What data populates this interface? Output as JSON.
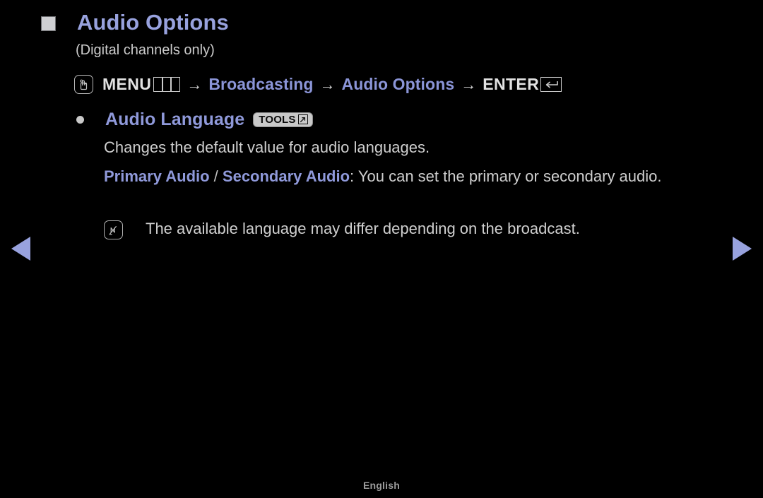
{
  "page": {
    "language_footer": "English",
    "background_color": "#000000",
    "accent_color": "#98a2de",
    "text_color": "#cfcfcf"
  },
  "header": {
    "marker_icon": "filled-square-icon",
    "title": "Audio Options",
    "subtitle": "(Digital channels only)"
  },
  "menu_path": {
    "touch_icon": "hand-press-icon",
    "segments": [
      {
        "type": "key",
        "label": "MENU",
        "glyph": "menu-grid-glyph",
        "style": "white"
      },
      {
        "type": "arrow",
        "label": "→"
      },
      {
        "type": "menu",
        "label": "Broadcasting",
        "style": "blue"
      },
      {
        "type": "arrow",
        "label": "→"
      },
      {
        "type": "menu",
        "label": "Audio Options",
        "style": "blue"
      },
      {
        "type": "arrow",
        "label": "→"
      },
      {
        "type": "key",
        "label": "ENTER",
        "glyph": "enter-return-glyph",
        "style": "white"
      }
    ]
  },
  "content": {
    "bullet_icon": "bullet-dot-icon",
    "item_title": "Audio Language",
    "tools_badge": {
      "label": "TOOLS",
      "icon": "arrow-out-box-icon"
    },
    "description_1": "Changes the default value for audio languages.",
    "description_2": {
      "term_primary": "Primary Audio",
      "separator": " / ",
      "term_secondary": "Secondary Audio",
      "rest": ": You can set the primary or secondary audio."
    },
    "note": {
      "icon": "note-pen-icon",
      "text": "The available language may differ depending on the broadcast."
    }
  },
  "navigation": {
    "prev_label": "previous page",
    "prev_icon": "triangle-left-icon",
    "next_label": "next page",
    "next_icon": "triangle-right-icon"
  }
}
